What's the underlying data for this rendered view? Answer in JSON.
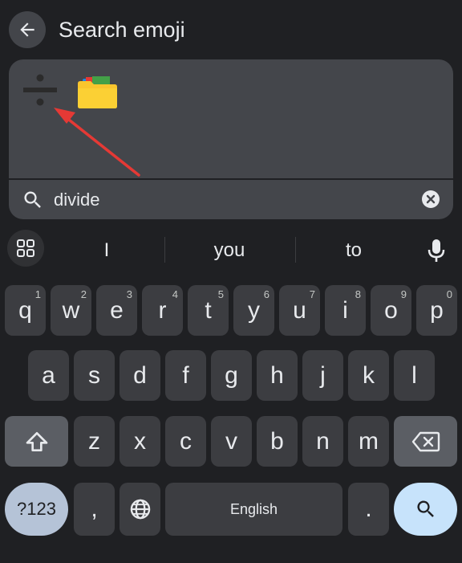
{
  "header": {
    "back_icon": "arrow-left-icon",
    "title": "Search emoji"
  },
  "emoji_results": [
    {
      "name": "divide",
      "glyph": "÷",
      "selected": true
    },
    {
      "name": "file folder",
      "icon": "folder-icon"
    }
  ],
  "search": {
    "icon": "search-icon",
    "value": "divide",
    "clear_icon": "close-circle-icon"
  },
  "suggestions": [
    "I",
    "you",
    "to"
  ],
  "keyboard": {
    "row1": [
      {
        "label": "q",
        "hint": "1"
      },
      {
        "label": "w",
        "hint": "2"
      },
      {
        "label": "e",
        "hint": "3"
      },
      {
        "label": "r",
        "hint": "4"
      },
      {
        "label": "t",
        "hint": "5"
      },
      {
        "label": "y",
        "hint": "6"
      },
      {
        "label": "u",
        "hint": "7"
      },
      {
        "label": "i",
        "hint": "8"
      },
      {
        "label": "o",
        "hint": "9"
      },
      {
        "label": "p",
        "hint": "0"
      }
    ],
    "row2": [
      "a",
      "s",
      "d",
      "f",
      "g",
      "h",
      "j",
      "k",
      "l"
    ],
    "row3": [
      "z",
      "x",
      "c",
      "v",
      "b",
      "n",
      "m"
    ],
    "symbols_label": "?123",
    "comma_label": ",",
    "space_label": "English",
    "period_label": ".",
    "icons": {
      "shift": "shift-icon",
      "backspace": "backspace-icon",
      "globe": "globe-icon",
      "enter": "search-icon",
      "emoji_grid": "grid-icon",
      "mic": "mic-icon"
    }
  },
  "colors": {
    "background": "#1f2023",
    "panel": "#44464b",
    "key": "#3c3d41",
    "modifier_key": "#5b5e64",
    "symbols_key": "#b5c3d7",
    "enter_key": "#c7e3fb",
    "annotation_arrow": "#e53935"
  }
}
